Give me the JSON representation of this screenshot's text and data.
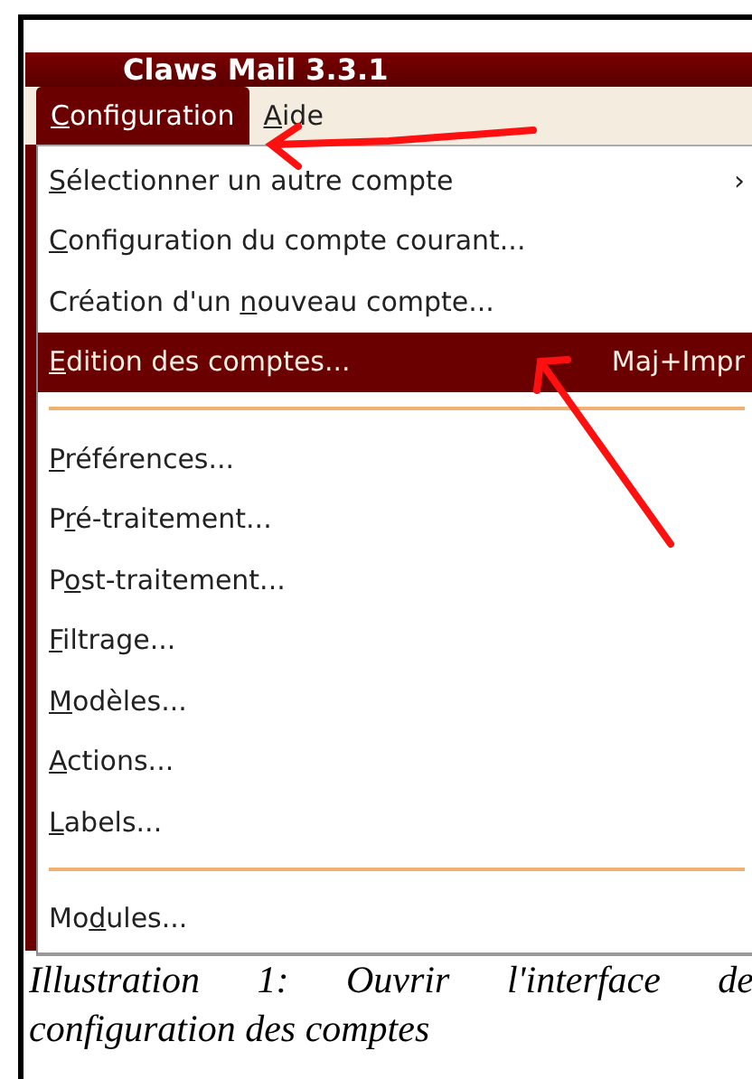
{
  "window": {
    "title": "Claws Mail 3.3.1"
  },
  "menubar": [
    {
      "key": "C",
      "after": "onfiguration",
      "selected": true
    },
    {
      "key": "A",
      "after": "ide",
      "selected": false
    }
  ],
  "menu": {
    "items": [
      {
        "kind": "item",
        "key": "S",
        "after": "électionner un autre compte",
        "arrow": "›",
        "selected": false
      },
      {
        "kind": "item",
        "key": "C",
        "after": "onfiguration du compte courant...",
        "selected": false
      },
      {
        "kind": "item",
        "before": "Création d'un ",
        "key": "n",
        "after": "ouveau compte...",
        "selected": false
      },
      {
        "kind": "item",
        "key": "E",
        "after": "dition des comptes...",
        "shortcut": "Maj+Impr",
        "selected": true
      },
      {
        "kind": "separator"
      },
      {
        "kind": "item",
        "key": "P",
        "after": "références...",
        "selected": false
      },
      {
        "kind": "item",
        "before": "P",
        "key": "r",
        "after": "é-traitement...",
        "selected": false
      },
      {
        "kind": "item",
        "before": "P",
        "key": "o",
        "after": "st-traitement...",
        "selected": false
      },
      {
        "kind": "item",
        "key": "F",
        "after": "iltrage...",
        "selected": false
      },
      {
        "kind": "item",
        "key": "M",
        "after": "odèles...",
        "selected": false
      },
      {
        "kind": "item",
        "key": "A",
        "after": "ctions...",
        "selected": false
      },
      {
        "kind": "item",
        "key": "L",
        "after": "abels...",
        "selected": false
      },
      {
        "kind": "separator"
      },
      {
        "kind": "item",
        "before": "Mo",
        "key": "d",
        "after": "ules...",
        "selected": false
      }
    ]
  },
  "caption": "Illustration 1: Ouvrir l'interface de configuration des comptes"
}
